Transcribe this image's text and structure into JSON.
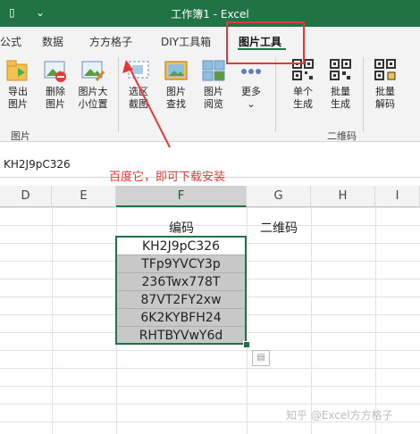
{
  "titlebar": {
    "title": "工作簿1 - Excel",
    "qat_icon": "customize-qat-icon",
    "doc_icon": "file-icon"
  },
  "tabs": [
    {
      "label": "公式"
    },
    {
      "label": "数据"
    },
    {
      "label": "方方格子"
    },
    {
      "label": "DIY工具箱"
    },
    {
      "label": "图片工具",
      "active": true
    }
  ],
  "ribbon": {
    "buttons": [
      {
        "label1": "导出",
        "label2": "图片",
        "icon": "export-picture-icon"
      },
      {
        "label1": "删除",
        "label2": "图片",
        "icon": "delete-picture-icon"
      },
      {
        "label1": "图片大",
        "label2": "小位置",
        "icon": "picture-size-icon"
      },
      {
        "label1": "选区",
        "label2": "截图",
        "icon": "screenshot-icon"
      },
      {
        "label1": "图片",
        "label2": "查找",
        "icon": "picture-find-icon"
      },
      {
        "label1": "图片",
        "label2": "阅览",
        "icon": "picture-browse-icon"
      },
      {
        "label1": "更多",
        "label2": "⌄",
        "icon": "more-icon"
      },
      {
        "label1": "单个",
        "label2": "生成",
        "icon": "qr-single-icon"
      },
      {
        "label1": "批量",
        "label2": "生成",
        "icon": "qr-batch-icon"
      },
      {
        "label1": "批量",
        "label2": "解码",
        "icon": "qr-decode-icon"
      }
    ],
    "group_picture": "图片",
    "group_qrcode": "二维码"
  },
  "namebox": {
    "value": "KH2J9pC326"
  },
  "annotation": "百度它，即可下载安装",
  "columns": [
    "D",
    "E",
    "F",
    "G",
    "H",
    "I"
  ],
  "sheet": {
    "header_f": "编码",
    "header_g": "二维码",
    "codes": [
      "KH2J9pC326",
      "TFp9YVCY3p",
      "236Twx778T",
      "87VT2FY2xw",
      "6K2KYBFH24",
      "RHTBYVwY6d"
    ]
  },
  "watermark": "知乎 @Excel方方格子",
  "colors": {
    "accent": "#217346",
    "annotation": "#e53935"
  }
}
